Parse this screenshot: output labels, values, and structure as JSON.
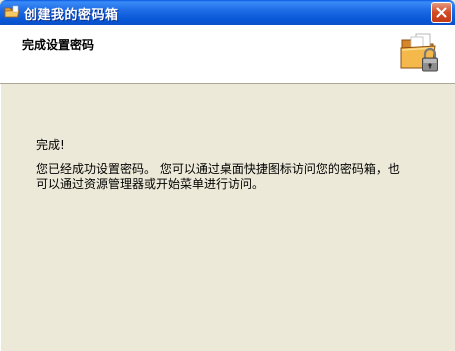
{
  "window": {
    "title": "创建我的密码箱",
    "icon": "folder-icon",
    "close_icon": "close-icon"
  },
  "header": {
    "title": "完成设置密码",
    "icon": "folder-lock-icon"
  },
  "main": {
    "done": "完成!",
    "desc_line1": "您已经成功设置密码。 您可以通过桌面快捷图标访问您的密码箱，也",
    "desc_line2": "可以通过资源管理器或开始菜单进行访问。"
  },
  "colors": {
    "titlebar": "#0857D6",
    "close_button": "#D24B25",
    "content_bg": "#ECE9D8",
    "header_bg": "#FFFFFF"
  }
}
